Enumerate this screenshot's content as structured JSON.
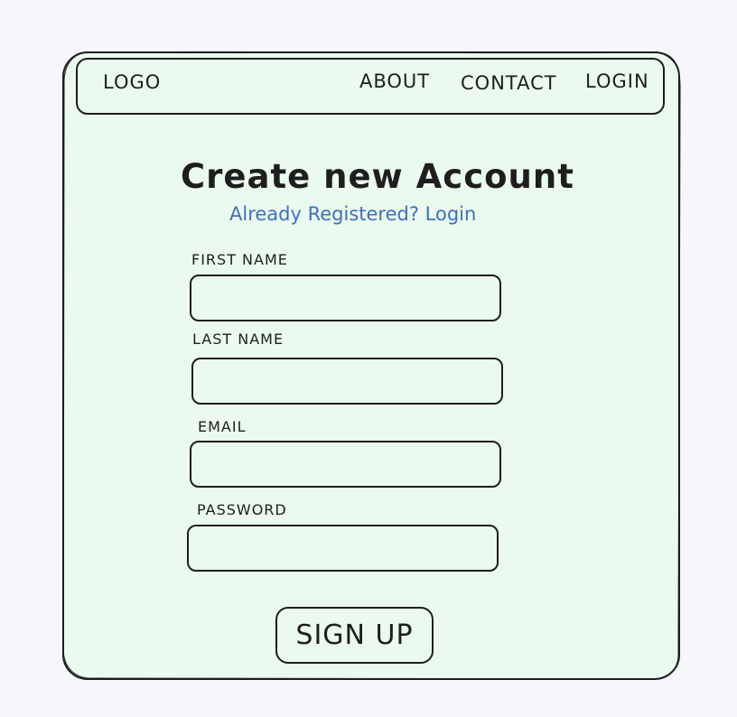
{
  "nav": {
    "logo": "LOGO",
    "items": [
      "ABOUT",
      "CONTACT",
      "LOGIN"
    ]
  },
  "form": {
    "title": "Create new Account",
    "login_link": "Already Registered? Login",
    "fields": [
      {
        "label": "FIRST NAME",
        "value": ""
      },
      {
        "label": "LAST NAME",
        "value": ""
      },
      {
        "label": "EMAIL",
        "value": ""
      },
      {
        "label": "PASSWORD",
        "value": ""
      }
    ],
    "submit_label": "SIGN UP"
  },
  "colors": {
    "page_background": "#f6f7fa",
    "card_background": "#ebfaee",
    "stroke": "#1e1e1e",
    "link": "#3f6fc2"
  }
}
